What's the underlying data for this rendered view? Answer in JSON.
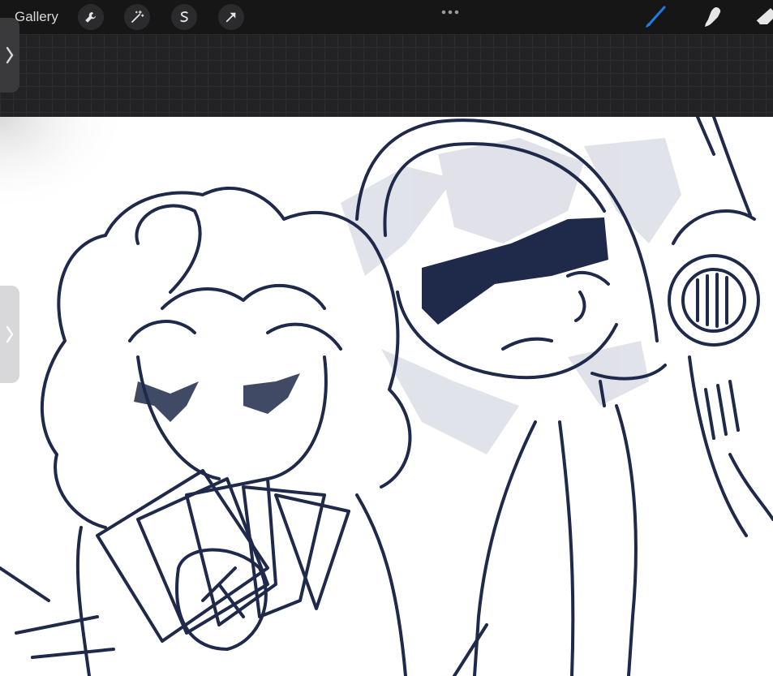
{
  "header": {
    "gallery_label": "Gallery",
    "left_tools": [
      {
        "name": "actions-wrench-icon"
      },
      {
        "name": "adjustments-wand-icon"
      },
      {
        "name": "selection-s-icon"
      },
      {
        "name": "transform-arrow-icon"
      }
    ],
    "right_tools": [
      {
        "name": "brush-icon",
        "active": true
      },
      {
        "name": "smudge-icon",
        "active": false
      },
      {
        "name": "eraser-icon",
        "active": false
      }
    ],
    "menu_dots": "more-options-icon"
  },
  "colors": {
    "accent_blue": "#1e7be8",
    "ink": "#1f2a4a",
    "toolbar_bg": "#161617",
    "canvas_bg": "#ffffff"
  },
  "sidebar": {
    "upper_toggle": "chevron-right-icon",
    "lower_toggle": "chevron-right-icon"
  }
}
